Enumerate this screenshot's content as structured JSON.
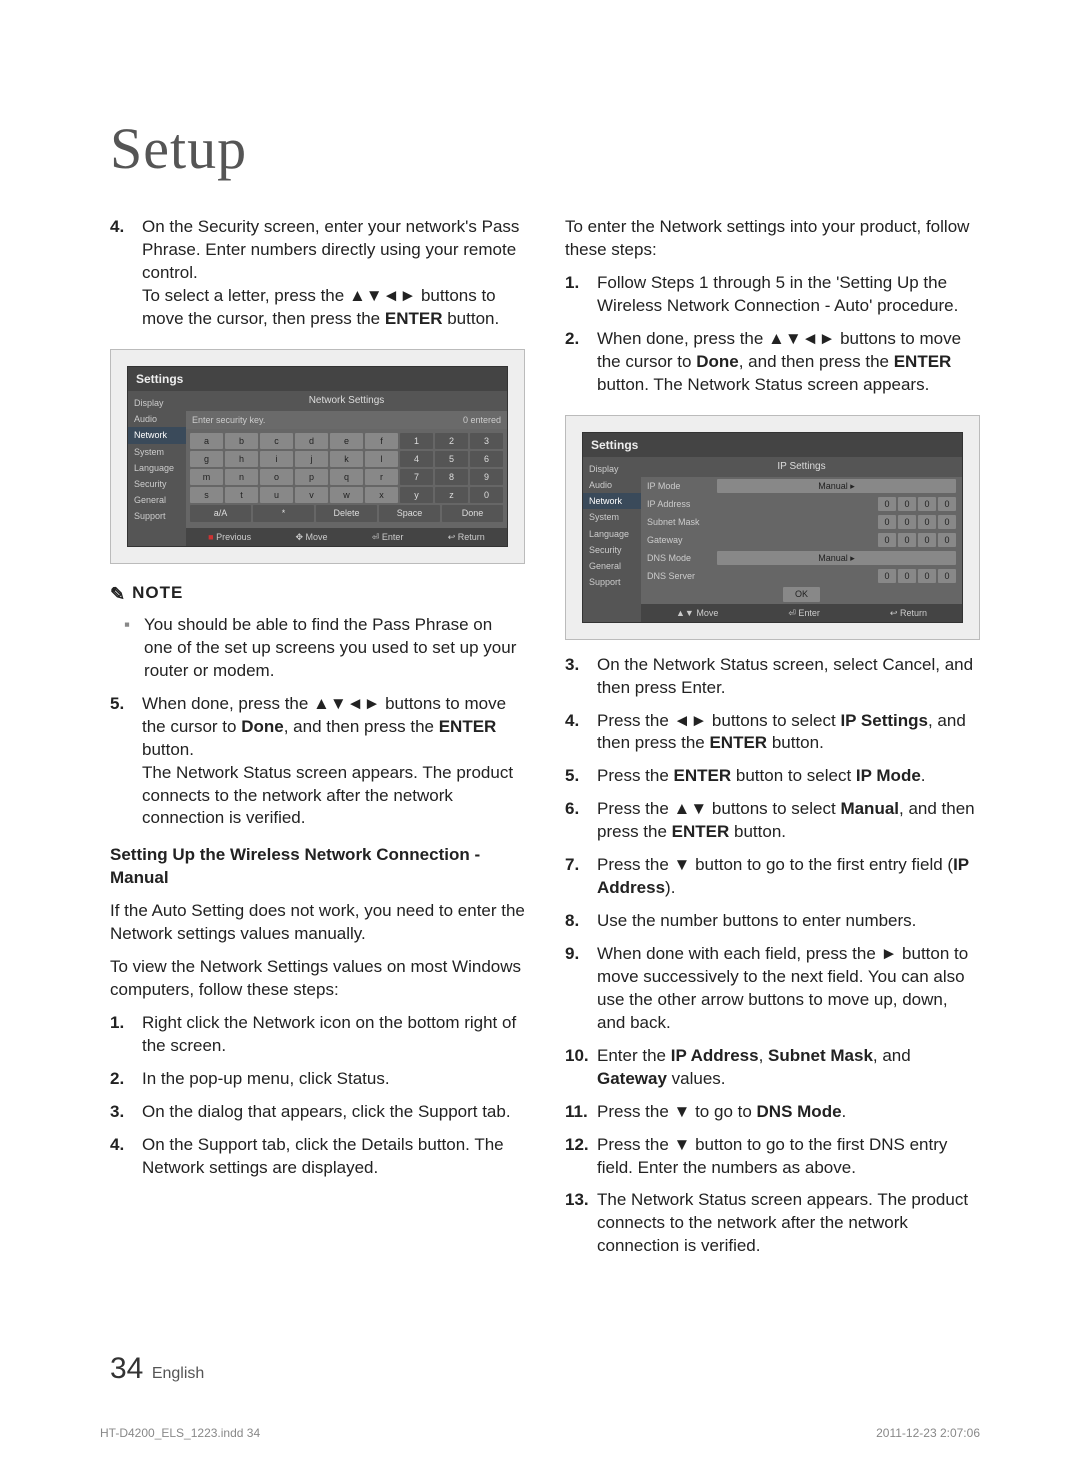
{
  "title": "Setup",
  "left": {
    "step4": "On the Security screen, enter your network's Pass Phrase. Enter numbers directly using your remote control.\nTo select a letter, press the ▲▼◄► buttons to move the cursor, then press the ENTER button.",
    "shot1": {
      "title": "Settings",
      "panel_title": "Network Settings",
      "menu": [
        "Display",
        "Audio",
        "Network",
        "System",
        "Language",
        "Security",
        "General",
        "Support"
      ],
      "prompt_left": "Enter security key.",
      "prompt_right": "0 entered",
      "keys": [
        [
          "a",
          "b",
          "c",
          "d",
          "e",
          "f",
          "1",
          "2",
          "3"
        ],
        [
          "g",
          "h",
          "i",
          "j",
          "k",
          "l",
          "4",
          "5",
          "6"
        ],
        [
          "m",
          "n",
          "o",
          "p",
          "q",
          "r",
          "7",
          "8",
          "9"
        ],
        [
          "s",
          "t",
          "u",
          "v",
          "w",
          "x",
          "y",
          "z",
          "0"
        ]
      ],
      "func_row": [
        "a/A",
        "*",
        "Delete",
        "Space",
        "Done"
      ],
      "footer": [
        "Previous",
        "Move",
        "Enter",
        "Return"
      ]
    },
    "note_head": "NOTE",
    "note1": "You should be able to find the Pass Phrase on one of the set up screens you used to set up your router or modem.",
    "step5_a": "When done, press the ▲▼◄► buttons to move the cursor to ",
    "step5_done": "Done",
    "step5_b": ", and then press the ",
    "step5_enter": "ENTER",
    "step5_c": " button.",
    "step5_d": "The Network Status screen appears. The product connects to the network after the network connection is verified.",
    "subhead": "Setting Up the Wireless Network Connection - Manual",
    "para1": "If the Auto Setting does not work, you need to enter the Network settings values manually.",
    "para2": "To view the Network Settings values on most Windows computers, follow these steps:",
    "win_steps": [
      "Right click the Network icon on the bottom right of the screen.",
      "In the pop-up menu, click Status.",
      "On the dialog that appears, click the Support tab.",
      "On the Support tab, click the Details button. The Network settings are displayed."
    ]
  },
  "right": {
    "intro": "To enter the Network settings into your product, follow these steps:",
    "step1": "Follow Steps 1 through 5 in the 'Setting Up the Wireless Network Connection - Auto' procedure.",
    "step2_a": "When done, press the ▲▼◄► buttons to move the cursor to ",
    "step2_done": "Done",
    "step2_b": ", and then press the ",
    "step2_enter": "ENTER",
    "step2_c": " button. The Network Status screen appears.",
    "shot2": {
      "title": "Settings",
      "panel_title": "IP Settings",
      "menu": [
        "Display",
        "Audio",
        "Network",
        "System",
        "Language",
        "Security",
        "General",
        "Support"
      ],
      "rows": [
        {
          "label": "IP Mode",
          "type": "text",
          "value": "Manual"
        },
        {
          "label": "IP Address",
          "type": "ip",
          "value": [
            "0",
            "0",
            "0",
            "0"
          ]
        },
        {
          "label": "Subnet Mask",
          "type": "ip",
          "value": [
            "0",
            "0",
            "0",
            "0"
          ]
        },
        {
          "label": "Gateway",
          "type": "ip",
          "value": [
            "0",
            "0",
            "0",
            "0"
          ]
        },
        {
          "label": "DNS Mode",
          "type": "text",
          "value": "Manual"
        },
        {
          "label": "DNS Server",
          "type": "ip",
          "value": [
            "0",
            "0",
            "0",
            "0"
          ]
        }
      ],
      "ok": "OK",
      "footer": [
        "Move",
        "Enter",
        "Return"
      ]
    },
    "steps_after": [
      {
        "n": "3.",
        "t": "On the Network Status screen, select Cancel, and then press Enter."
      },
      {
        "n": "4.",
        "t": "Press the ◄► buttons to select IP Settings, and then press the ENTER button."
      },
      {
        "n": "5.",
        "t": "Press the ENTER button to select IP Mode."
      },
      {
        "n": "6.",
        "t": "Press the ▲▼ buttons to select Manual, and then press the ENTER button."
      },
      {
        "n": "7.",
        "t": "Press the ▼ button to go to the first entry field (IP Address)."
      },
      {
        "n": "8.",
        "t": "Use the number buttons to enter numbers."
      },
      {
        "n": "9.",
        "t": "When done with each field, press the ► button to move successively to the next field. You can also use the other arrow buttons to move up, down, and back."
      },
      {
        "n": "10.",
        "t": "Enter the IP Address, Subnet Mask, and Gateway values."
      },
      {
        "n": "11.",
        "t": "Press the ▼ to go to DNS Mode."
      },
      {
        "n": "12.",
        "t": "Press the ▼ button to go to the first DNS entry field. Enter the numbers as above."
      },
      {
        "n": "13.",
        "t": "The Network Status screen appears. The product connects to the network after the network connection is verified."
      }
    ]
  },
  "page_number": "34",
  "page_lang": "English",
  "footer_left": "HT-D4200_ELS_1223.indd   34",
  "footer_right": "2011-12-23   2:07:06"
}
